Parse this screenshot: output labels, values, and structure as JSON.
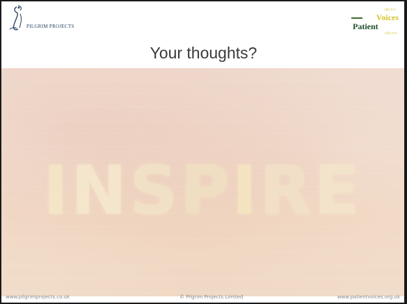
{
  "header": {
    "left_logo": {
      "brand": "PILGRIM PROJECTS",
      "icon": "pilgrim-figure-logo"
    },
    "right_logo": {
      "word_top": "effective",
      "word_voices": "Voices",
      "word_patient": "Patient",
      "word_bottom": "reflective"
    }
  },
  "slide": {
    "title": "Your thoughts?",
    "background_text": [
      "I",
      "N",
      "S",
      "P",
      "I",
      "R",
      "E"
    ]
  },
  "footer": {
    "left": "www.pilgrimprojects.co.uk",
    "center": "© Pilgrim Projects Limited",
    "right": "www.patientvoices.org.uk"
  },
  "colors": {
    "title": "#3a3a3a",
    "footer": "#8a8a8a",
    "brand_blue": "#1f3a5a",
    "voices_yellow": "#d6c52e",
    "patient_green": "#1f4e2a"
  }
}
